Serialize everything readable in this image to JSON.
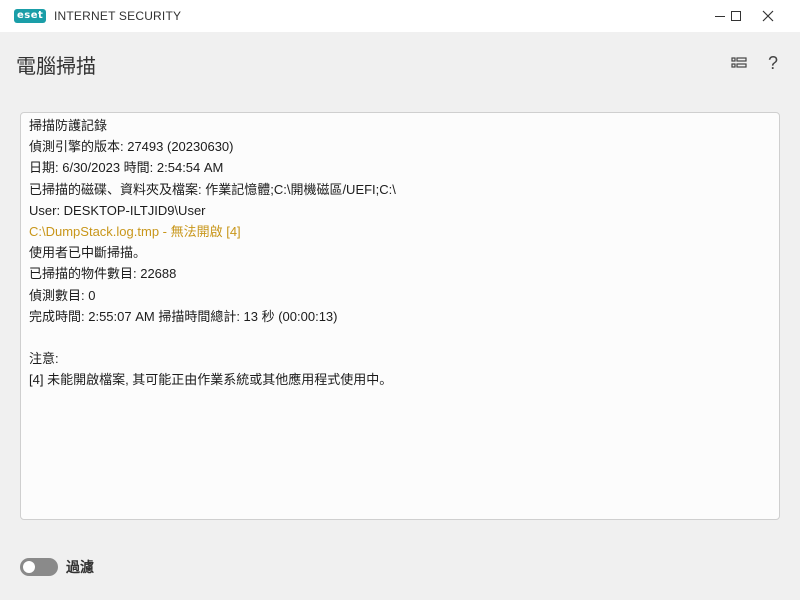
{
  "window": {
    "logo_text": "eset",
    "app_title": "INTERNET SECURITY"
  },
  "header": {
    "title": "電腦掃描",
    "help_glyph": "?"
  },
  "log": {
    "lines": [
      {
        "text": "掃描防護記錄",
        "status": "normal"
      },
      {
        "text": "偵測引擎的版本: 27493 (20230630)",
        "status": "normal"
      },
      {
        "text": "日期: 6/30/2023  時間: 2:54:54 AM",
        "status": "normal"
      },
      {
        "text": "已掃描的磁碟、資料夾及檔案: 作業記憶體;C:\\開機磁區/UEFI;C:\\",
        "status": "normal"
      },
      {
        "text": "User: DESKTOP-ILTJID9\\User",
        "status": "normal"
      },
      {
        "text": "C:\\DumpStack.log.tmp - 無法開啟 [4]",
        "status": "warning"
      },
      {
        "text": "使用者已中斷掃描。",
        "status": "normal"
      },
      {
        "text": "已掃描的物件數目: 22688",
        "status": "normal"
      },
      {
        "text": "偵測數目: 0",
        "status": "normal"
      },
      {
        "text": "完成時間: 2:55:07 AM  掃描時間總計: 13 秒 (00:00:13)",
        "status": "normal"
      },
      {
        "text": "",
        "status": "normal"
      },
      {
        "text": "注意:",
        "status": "normal"
      },
      {
        "text": "[4] 未能開啟檔案, 其可能正由作業系統或其他應用程式使用中。",
        "status": "normal"
      }
    ]
  },
  "filter": {
    "label": "過濾",
    "enabled": false
  },
  "colors": {
    "warning_text": "#c8961a",
    "brand": "#1a9ea8"
  }
}
